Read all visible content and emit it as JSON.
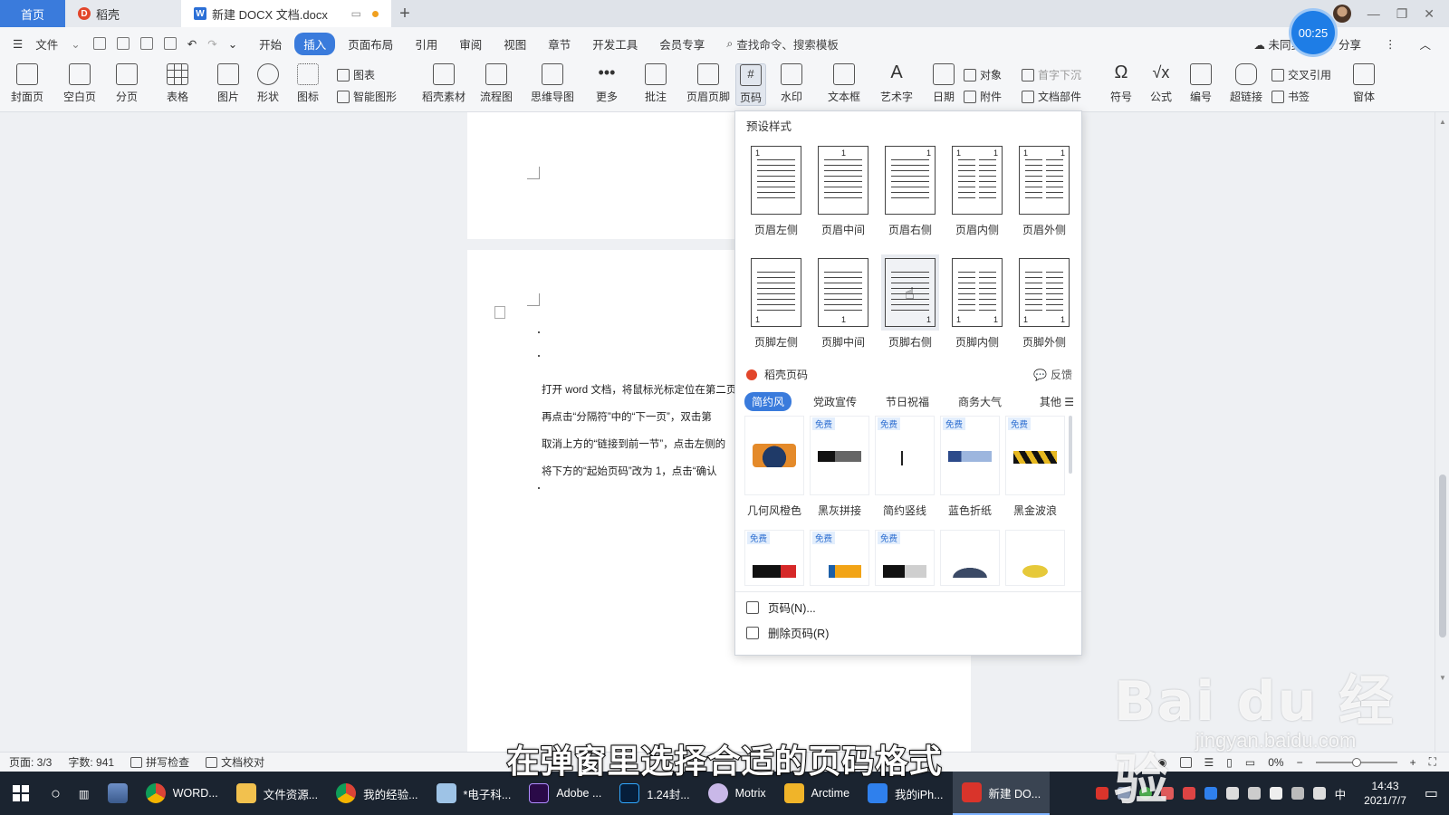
{
  "tabs": {
    "home": "首页",
    "daoke": "稻壳",
    "doc": "新建 DOCX 文档.docx",
    "new_tab": "+"
  },
  "timer": "00:25",
  "menubar": {
    "file": "文件",
    "items": [
      "开始",
      "插入",
      "页面布局",
      "引用",
      "审阅",
      "视图",
      "章节",
      "开发工具",
      "会员专享"
    ],
    "active_index": 1,
    "search_text": "查找命令、搜索模板",
    "sync": "未同步",
    "share": "分享"
  },
  "ribbon": {
    "cover": "封面页",
    "blank": "空白页",
    "pagebreak": "分页",
    "table": "表格",
    "picture": "图片",
    "shape": "形状",
    "icon": "图标",
    "chart": "图表",
    "smartart": "智能图形",
    "daoke_mat": "稻壳素材",
    "flowchart": "流程图",
    "mindmap": "思维导图",
    "more": "更多",
    "comment": "批注",
    "header_footer": "页眉页脚",
    "page_number": "页码",
    "watermark": "水印",
    "textbox": "文本框",
    "wordart": "艺术字",
    "date": "日期",
    "object": "对象",
    "attachment": "附件",
    "dropcap": "首字下沉",
    "docpart": "文档部件",
    "symbol": "符号",
    "formula": "公式",
    "numbering": "编号",
    "hyperlink": "超链接",
    "crossref": "交叉引用",
    "bookmark": "书签",
    "window": "窗体"
  },
  "document": {
    "lines": [
      "打开 word 文档，将鼠标光标定位在第二页",
      "再点击“分隔符”中的“下一页”，双击第",
      "取消上方的“链接到前一节”，点击左侧的",
      "将下方的“起始页码”改为 1，点击“确认"
    ]
  },
  "dropdown": {
    "title": "预设样式",
    "header_presets": [
      {
        "label": "页眉左侧",
        "num": "1"
      },
      {
        "label": "页眉中间",
        "num": "1"
      },
      {
        "label": "页眉右侧",
        "num": "1"
      },
      {
        "label": "页眉内侧",
        "num": "1"
      },
      {
        "label": "页眉外侧",
        "num": "1"
      }
    ],
    "footer_presets": [
      {
        "label": "页脚左侧",
        "num": "1"
      },
      {
        "label": "页脚中间",
        "num": "1"
      },
      {
        "label": "页脚右侧",
        "num": "1"
      },
      {
        "label": "页脚内侧",
        "num": "1"
      },
      {
        "label": "页脚外侧",
        "num": "1"
      }
    ],
    "daoke_title": "稻壳页码",
    "feedback": "反馈",
    "categories": [
      "简约风",
      "党政宣传",
      "节日祝福",
      "商务大气"
    ],
    "active_category": 0,
    "other": "其他",
    "free_badge": "免费",
    "templates_row1": [
      "几何风橙色",
      "黑灰拼接",
      "简约竖线",
      "蓝色折纸",
      "黑金波浪"
    ],
    "page_number_cmd": "页码(N)...",
    "delete_cmd": "删除页码(R)"
  },
  "statusbar": {
    "page": "页面: 3/3",
    "words": "字数: 941",
    "spell": "拼写检查",
    "proof": "文档校对",
    "zoom": "0%"
  },
  "subtitle": "在弹窗里选择合适的页码格式",
  "watermark": {
    "logo": "Bai du 经验",
    "url": "jingyan.baidu.com"
  },
  "taskbar": {
    "items": [
      "WORD...",
      "文件资源...",
      "我的经验...",
      "*电子科...",
      "Adobe ...",
      "1.24封...",
      "Motrix",
      "Arctime",
      "我的iPh...",
      "新建 DO..."
    ],
    "time": "14:43",
    "date": "2021/7/7",
    "ime": "中"
  },
  "colors": {
    "accent": "#3a7bdc",
    "taskbar_bg": "#1b2430",
    "daoke_red": "#e2462b"
  }
}
